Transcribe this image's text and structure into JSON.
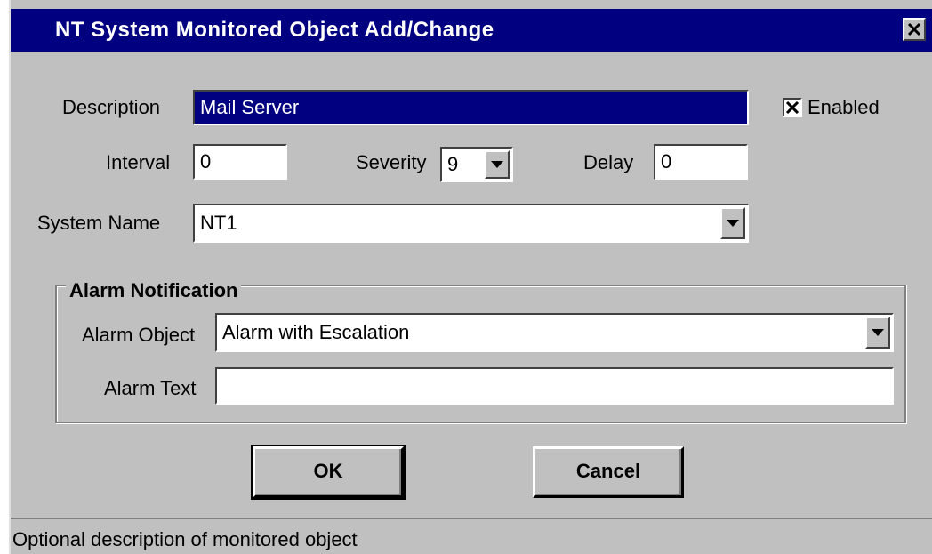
{
  "window": {
    "title": "NT System Monitored Object Add/Change",
    "close_icon": "close-x-icon"
  },
  "form": {
    "description": {
      "label": "Description",
      "value": "Mail Server"
    },
    "enabled": {
      "label": "Enabled",
      "checked": true
    },
    "interval": {
      "label": "Interval",
      "value": "0"
    },
    "severity": {
      "label": "Severity",
      "value": "9"
    },
    "delay": {
      "label": "Delay",
      "value": "0"
    },
    "system_name": {
      "label": "System Name",
      "value": "NT1"
    }
  },
  "alarm_notification": {
    "group_label": "Alarm Notification",
    "alarm_object": {
      "label": "Alarm Object",
      "value": "Alarm with Escalation"
    },
    "alarm_text": {
      "label": "Alarm Text",
      "value": ""
    }
  },
  "buttons": {
    "ok": "OK",
    "cancel": "Cancel"
  },
  "status_bar": {
    "text": "Optional description of monitored object"
  },
  "colors": {
    "title_bar": "#000080",
    "dialog_face": "#c0c0c0",
    "selection": "#000080"
  }
}
